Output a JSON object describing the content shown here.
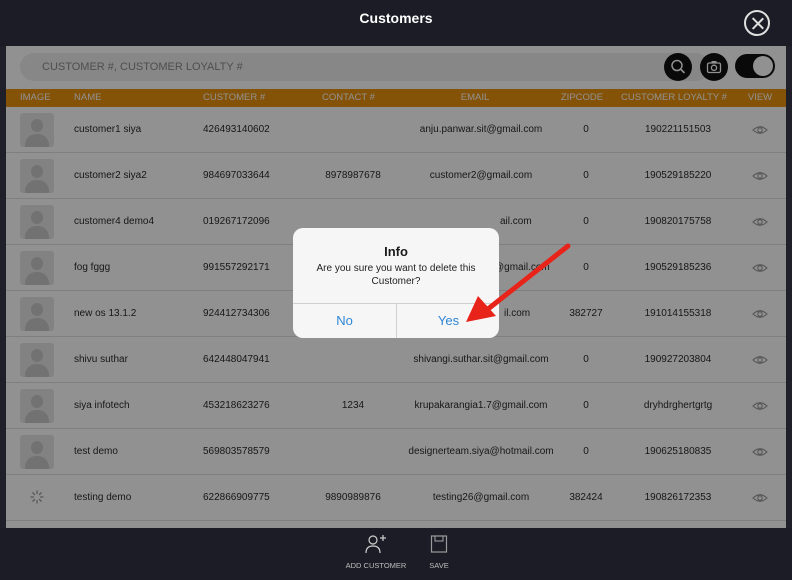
{
  "header": {
    "title": "Customers"
  },
  "search": {
    "placeholder": "CUSTOMER #, CUSTOMER LOYALTY #"
  },
  "icons": {
    "close": "close-icon",
    "search": "search-icon",
    "camera": "camera-icon",
    "view": "eye-icon",
    "add": "add-user-icon",
    "save": "save-icon",
    "loading": "spinner-icon"
  },
  "colors": {
    "accent": "#e8920e",
    "dialog_button": "#2f86d6",
    "arrow": "#e8231a"
  },
  "table": {
    "columns": [
      "IMAGE",
      "NAME",
      "CUSTOMER #",
      "CONTACT #",
      "EMAIL",
      "ZIPCODE",
      "CUSTOMER LOYALTY #",
      "VIEW"
    ],
    "rows": [
      {
        "name": "customer1 siya",
        "customer": "426493140602",
        "contact": "",
        "email": "anju.panwar.sit@gmail.com",
        "zip": "0",
        "loyalty": "190221151503",
        "image": "avatar"
      },
      {
        "name": "customer2 siya2",
        "customer": "984697033644",
        "contact": "8978987678",
        "email": "customer2@gmail.com",
        "zip": "0",
        "loyalty": "190529185220",
        "image": "avatar"
      },
      {
        "name": "customer4 demo4",
        "customer": "019267172096",
        "contact": "",
        "email": "ail.com",
        "zip": "0",
        "loyalty": "190820175758",
        "image": "avatar"
      },
      {
        "name": "fog fggg",
        "customer": "991557292171",
        "contact": "",
        "email": "@gmail.com",
        "zip": "0",
        "loyalty": "190529185236",
        "image": "avatar"
      },
      {
        "name": "new os 13.1.2",
        "customer": "924412734306",
        "contact": "",
        "email": "il.com",
        "zip": "382727",
        "loyalty": "191014155318",
        "image": "avatar"
      },
      {
        "name": "shivu suthar",
        "customer": "642448047941",
        "contact": "",
        "email": "shivangi.suthar.sit@gmail.com",
        "zip": "0",
        "loyalty": "190927203804",
        "image": "avatar"
      },
      {
        "name": "siya infotech",
        "customer": "453218623276",
        "contact": "1234",
        "email": "krupakarangia1.7@gmail.com",
        "zip": "0",
        "loyalty": "dryhdrghertgrtg",
        "image": "avatar"
      },
      {
        "name": "test demo",
        "customer": "569803578579",
        "contact": "",
        "email": "designerteam.siya@hotmail.com",
        "zip": "0",
        "loyalty": "190625180835",
        "image": "avatar"
      },
      {
        "name": "testing  demo",
        "customer": "622866909775",
        "contact": "9890989876",
        "email": "testing26@gmail.com",
        "zip": "382424",
        "loyalty": "190826172353",
        "image": "spinner"
      }
    ]
  },
  "dialog": {
    "title": "Info",
    "message": "Are you sure you want to delete this Customer?",
    "no": "No",
    "yes": "Yes"
  },
  "footer": {
    "add_customer": "ADD CUSTOMER",
    "save": "SAVE"
  }
}
